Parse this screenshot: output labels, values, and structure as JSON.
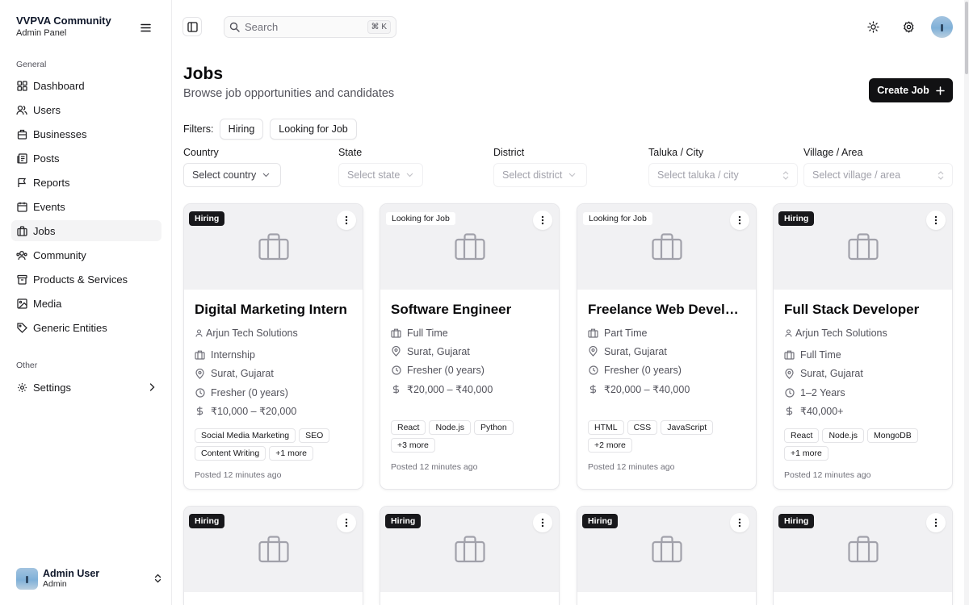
{
  "app": {
    "title": "VVPVA Community",
    "subtitle": "Admin Panel"
  },
  "sidebar": {
    "general_label": "General",
    "items": [
      {
        "label": "Dashboard",
        "icon": "dashboard-icon"
      },
      {
        "label": "Users",
        "icon": "users-icon"
      },
      {
        "label": "Businesses",
        "icon": "building-icon"
      },
      {
        "label": "Posts",
        "icon": "newspaper-icon"
      },
      {
        "label": "Reports",
        "icon": "flag-icon"
      },
      {
        "label": "Events",
        "icon": "calendar-icon"
      },
      {
        "label": "Jobs",
        "icon": "briefcase-icon",
        "active": true
      },
      {
        "label": "Community",
        "icon": "community-icon"
      },
      {
        "label": "Products & Services",
        "icon": "package-icon"
      },
      {
        "label": "Media",
        "icon": "image-icon"
      },
      {
        "label": "Generic Entities",
        "icon": "tag-icon"
      }
    ],
    "other_label": "Other",
    "settings_label": "Settings",
    "user": {
      "name": "Admin User",
      "role": "Admin"
    }
  },
  "topbar": {
    "search_placeholder": "Search",
    "search_shortcut": "⌘ K"
  },
  "header": {
    "title": "Jobs",
    "subtitle": "Browse job opportunities and candidates",
    "create_label": "Create Job"
  },
  "filters": {
    "label": "Filters:",
    "chips": [
      "Hiring",
      "Looking for Job"
    ],
    "country": {
      "label": "Country",
      "placeholder": "Select country"
    },
    "state": {
      "label": "State",
      "placeholder": "Select state"
    },
    "district": {
      "label": "District",
      "placeholder": "Select district"
    },
    "taluka": {
      "label": "Taluka / City",
      "placeholder": "Select taluka / city"
    },
    "village": {
      "label": "Village / Area",
      "placeholder": "Select village / area"
    }
  },
  "jobs": [
    {
      "badge": "Hiring",
      "badge_type": "hiring",
      "title": "Digital Marketing Intern",
      "company": "Arjun Tech Solutions",
      "type": "Internship",
      "location": "Surat, Gujarat",
      "experience": "Fresher (0 years)",
      "salary": "₹10,000 – ₹20,000",
      "tags": [
        "Social Media Marketing",
        "SEO",
        "Content Writing",
        "+1 more"
      ],
      "posted": "Posted 12 minutes ago"
    },
    {
      "badge": "Looking for Job",
      "badge_type": "looking",
      "title": "Software Engineer",
      "type": "Full Time",
      "location": "Surat, Gujarat",
      "experience": "Fresher (0 years)",
      "salary": "₹20,000 – ₹40,000",
      "tags": [
        "React",
        "Node.js",
        "Python",
        "+3 more"
      ],
      "posted": "Posted 12 minutes ago"
    },
    {
      "badge": "Looking for Job",
      "badge_type": "looking",
      "title": "Freelance Web Developer",
      "type": "Part Time",
      "location": "Surat, Gujarat",
      "experience": "Fresher (0 years)",
      "salary": "₹20,000 – ₹40,000",
      "tags": [
        "HTML",
        "CSS",
        "JavaScript",
        "+2 more"
      ],
      "posted": "Posted 12 minutes ago"
    },
    {
      "badge": "Hiring",
      "badge_type": "hiring",
      "title": "Full Stack Developer",
      "company": "Arjun Tech Solutions",
      "type": "Full Time",
      "location": "Surat, Gujarat",
      "experience": "1–2 Years",
      "salary": "₹40,000+",
      "tags": [
        "React",
        "Node.js",
        "MongoDB",
        "+1 more"
      ],
      "posted": "Posted 12 minutes ago"
    },
    {
      "badge": "Hiring",
      "badge_type": "hiring"
    },
    {
      "badge": "Hiring",
      "badge_type": "hiring"
    },
    {
      "badge": "Hiring",
      "badge_type": "hiring"
    },
    {
      "badge": "Hiring",
      "badge_type": "hiring"
    }
  ]
}
